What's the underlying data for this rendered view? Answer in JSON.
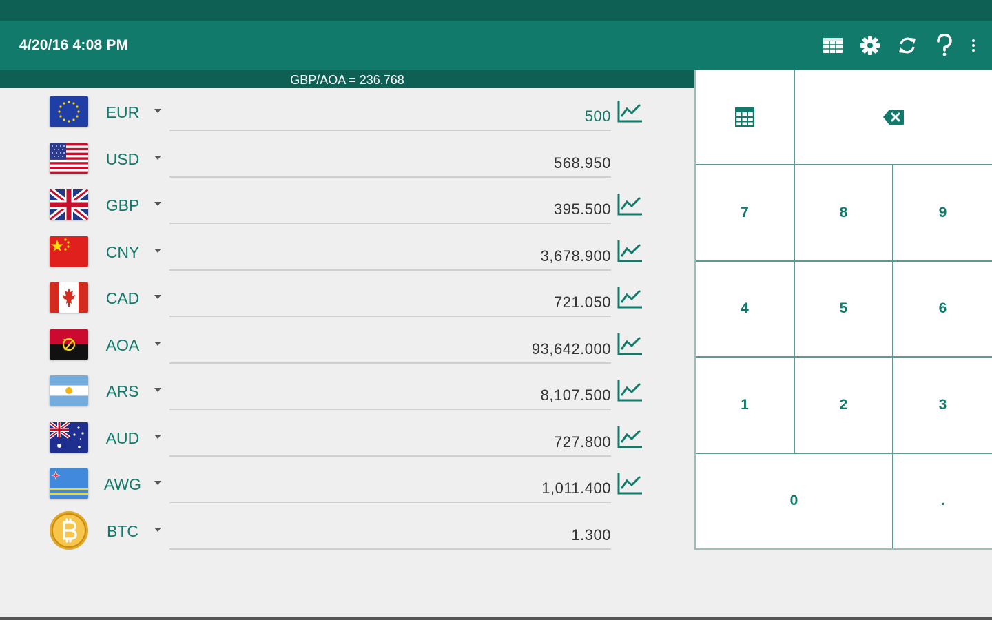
{
  "header": {
    "datetime": "4/20/16 4:08 PM",
    "actions": [
      "spreadsheet-icon",
      "gear-icon",
      "refresh-icon",
      "help-icon",
      "overflow-menu-icon"
    ]
  },
  "rate_strip": {
    "text": "GBP/AOA = 236.768"
  },
  "currencies": [
    {
      "code": "EUR",
      "value": "500",
      "active": true,
      "chart": true
    },
    {
      "code": "USD",
      "value": "568.950",
      "active": false,
      "chart": false
    },
    {
      "code": "GBP",
      "value": "395.500",
      "active": false,
      "chart": true
    },
    {
      "code": "CNY",
      "value": "3,678.900",
      "active": false,
      "chart": true
    },
    {
      "code": "CAD",
      "value": "721.050",
      "active": false,
      "chart": true
    },
    {
      "code": "AOA",
      "value": "93,642.000",
      "active": false,
      "chart": true
    },
    {
      "code": "ARS",
      "value": "8,107.500",
      "active": false,
      "chart": true
    },
    {
      "code": "AUD",
      "value": "727.800",
      "active": false,
      "chart": true
    },
    {
      "code": "AWG",
      "value": "1,011.400",
      "active": false,
      "chart": true
    },
    {
      "code": "BTC",
      "value": "1.300",
      "active": false,
      "chart": false
    }
  ],
  "keypad": {
    "digits": [
      "7",
      "8",
      "9",
      "4",
      "5",
      "6",
      "1",
      "2",
      "3"
    ],
    "zero": "0",
    "decimal": "."
  },
  "colors": {
    "primary": "#117a6b",
    "primary_dark": "#0e5f54",
    "background": "#efefef",
    "keypad_bg": "#ffffff"
  }
}
